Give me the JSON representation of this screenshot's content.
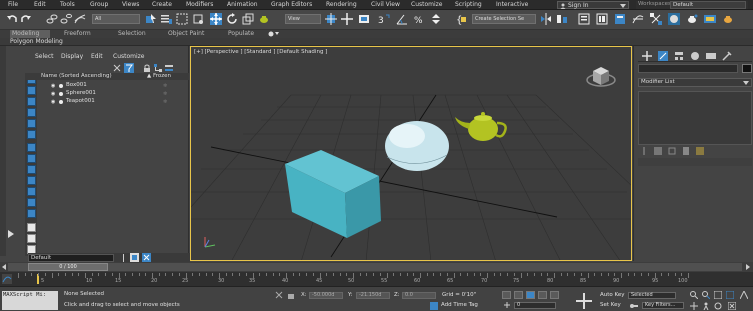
{
  "menubar": {
    "items": [
      "File",
      "Edit",
      "Tools",
      "Group",
      "Views",
      "Create",
      "Modifiers",
      "Animation",
      "Graph Editors",
      "Rendering",
      "Civil View",
      "Customize",
      "Scripting",
      "Interactive"
    ],
    "signin": "Sign In",
    "workspace_label": "Workspaces:",
    "workspace_value": "Default"
  },
  "toolbar": {
    "filter_value": "All",
    "refcoord_value": "View",
    "selection_set_placeholder": "Create Selection Se"
  },
  "ribbon": {
    "tabs": [
      "Modeling",
      "Freeform",
      "Selection",
      "Object Paint",
      "Populate"
    ],
    "panel_label": "Polygon Modeling"
  },
  "explorer": {
    "menu": [
      "Select",
      "Display",
      "Edit",
      "Customize"
    ],
    "column_name": "Name (Sorted Ascending)",
    "column_frozen": "▲ Frozen",
    "objects": [
      "Box001",
      "Sphere001",
      "Teapot001"
    ]
  },
  "layer": {
    "value": "Default"
  },
  "viewport": {
    "label": "[+] [Perspective ] [Standard ] [Default Shading ]",
    "colors": {
      "box": "#48b3c3",
      "sphere": "#c8e4ec",
      "teapot": "#b3c322",
      "border": "#e8c54a"
    }
  },
  "command_panel": {
    "modifier_list": "Modifier List"
  },
  "time_slider": {
    "value": "0 / 100"
  },
  "trackbar": {
    "ticks": [
      "0",
      "5",
      "10",
      "15",
      "20",
      "25",
      "30",
      "35",
      "40",
      "45",
      "50",
      "55",
      "60",
      "65",
      "70",
      "75",
      "80",
      "85",
      "90",
      "95",
      "100"
    ]
  },
  "status": {
    "maxscript": "MAXScript Mi:",
    "none_selected": "None Selected",
    "prompt": "Click and drag to select and move objects",
    "x_label": "X:",
    "x_placeholder": "-50.000d",
    "y_label": "Y:",
    "y_placeholder": "-21.150d",
    "z_label": "Z:",
    "z_placeholder": "0.0",
    "grid": "Grid = 0'10\"",
    "add_time_tag": "Add Time Tag",
    "frame": "0",
    "auto_key": "Auto Key",
    "selected": "Selected",
    "set_key": "Set Key",
    "key_filters": "Key Filters..."
  }
}
